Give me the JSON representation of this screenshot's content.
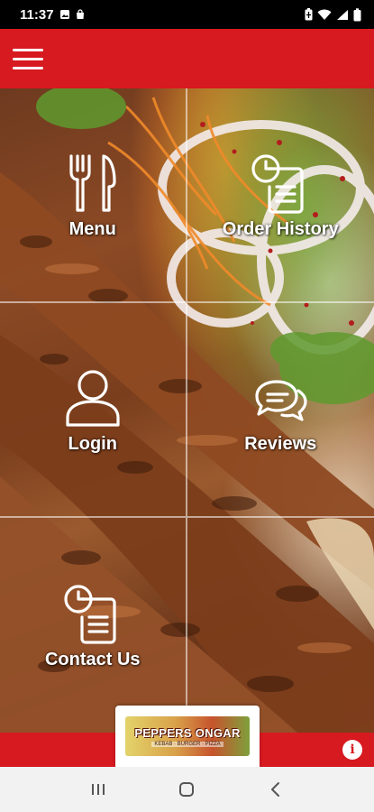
{
  "status_bar": {
    "time": "11:37",
    "left_icons": [
      "image-icon",
      "bag-icon"
    ],
    "right_icons": [
      "battery-saver-icon",
      "wifi-icon",
      "signal-icon",
      "battery-icon"
    ]
  },
  "header": {
    "menu_icon": "hamburger-icon",
    "background_color": "#d71920"
  },
  "tiles": [
    {
      "label": "Menu",
      "icon": "fork-knife-icon"
    },
    {
      "label": "Order History",
      "icon": "clock-document-icon"
    },
    {
      "label": "Login",
      "icon": "user-icon"
    },
    {
      "label": "Reviews",
      "icon": "chat-bubbles-icon"
    },
    {
      "label": "Contact Us",
      "icon": "clock-document-icon"
    },
    {
      "label": "",
      "icon": ""
    }
  ],
  "footer": {
    "logo_text": "PEPPERS ONGAR",
    "logo_subtext": "KEBAB · BURGER · PIZZA",
    "info_icon": "info-icon",
    "info_glyph": "i"
  },
  "navbar": {
    "icons": [
      "recent-apps-icon",
      "home-icon",
      "back-icon"
    ]
  },
  "colors": {
    "brand_red": "#d71920",
    "nav_bg": "#f2f2f2"
  }
}
